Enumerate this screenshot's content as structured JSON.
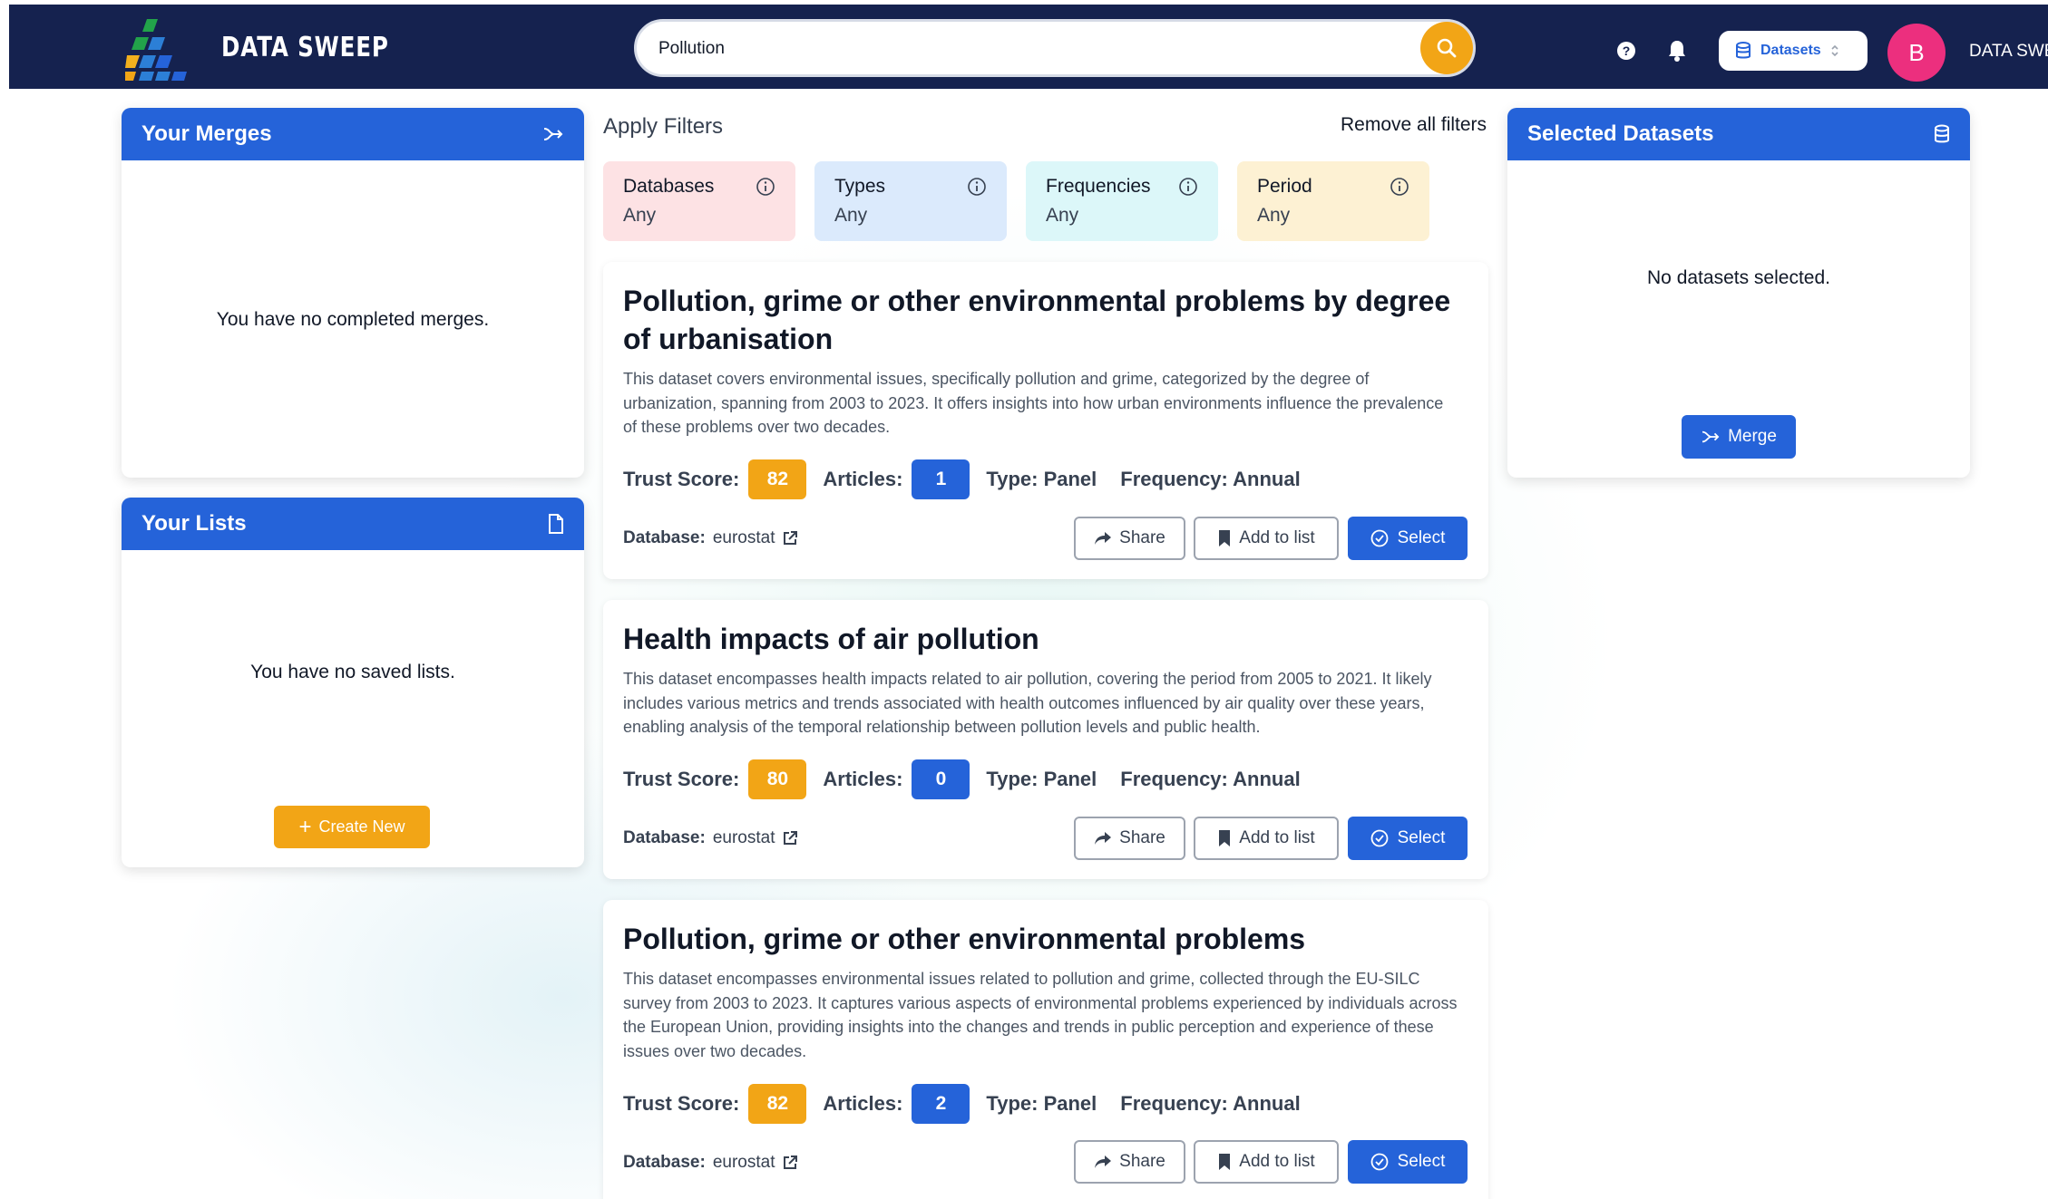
{
  "header": {
    "brand": "DATA SWEEP",
    "search_value": "Pollution",
    "dataset_selector": "Datasets",
    "avatar_initial": "B",
    "username": "DATA SWEEP"
  },
  "merges": {
    "title": "Your Merges",
    "empty_message": "You have no completed merges."
  },
  "lists": {
    "title": "Your Lists",
    "empty_message": "You have no saved lists.",
    "create_label": "Create New"
  },
  "filters": {
    "title": "Apply Filters",
    "remove_all": "Remove all filters",
    "items": [
      {
        "name": "Databases",
        "value": "Any",
        "color": "#fde2e4"
      },
      {
        "name": "Types",
        "value": "Any",
        "color": "#dbeafc"
      },
      {
        "name": "Frequencies",
        "value": "Any",
        "color": "#dcf7f9"
      },
      {
        "name": "Period",
        "value": "Any",
        "color": "#fdf1d3"
      }
    ]
  },
  "selected": {
    "title": "Selected Datasets",
    "empty_message": "No datasets selected.",
    "merge_label": "Merge"
  },
  "labels": {
    "trust_score": "Trust Score:",
    "articles": "Articles:",
    "database": "Database:",
    "share": "Share",
    "add_to_list": "Add to list",
    "select": "Select"
  },
  "datasets": [
    {
      "title": "Pollution, grime or other environmental problems by degree of urbanisation",
      "description": "This dataset covers environmental issues, specifically pollution and grime, categorized by the degree of urbanization, spanning from 2003 to 2023. It offers insights into how urban environments influence the prevalence of these problems over two decades.",
      "trust_score": "82",
      "articles": "1",
      "type": "Type: Panel",
      "frequency": "Frequency: Annual",
      "database": "eurostat"
    },
    {
      "title": "Health impacts of air pollution",
      "description": "This dataset encompasses health impacts related to air pollution, covering the period from 2005 to 2021. It likely includes various metrics and trends associated with health outcomes influenced by air quality over these years, enabling analysis of the temporal relationship between pollution levels and public health.",
      "trust_score": "80",
      "articles": "0",
      "type": "Type: Panel",
      "frequency": "Frequency: Annual",
      "database": "eurostat"
    },
    {
      "title": "Pollution, grime or other environmental problems",
      "description": "This dataset encompasses environmental issues related to pollution and grime, collected through the EU-SILC survey from 2003 to 2023. It captures various aspects of environmental problems experienced by individuals across the European Union, providing insights into the changes and trends in public perception and experience of these issues over two decades.",
      "trust_score": "82",
      "articles": "2",
      "type": "Type: Panel",
      "frequency": "Frequency: Annual",
      "database": "eurostat"
    }
  ],
  "colors": {
    "navy": "#15224f",
    "primary": "#2563d9",
    "accent": "#f2a516",
    "avatar": "#ec2f7e"
  }
}
